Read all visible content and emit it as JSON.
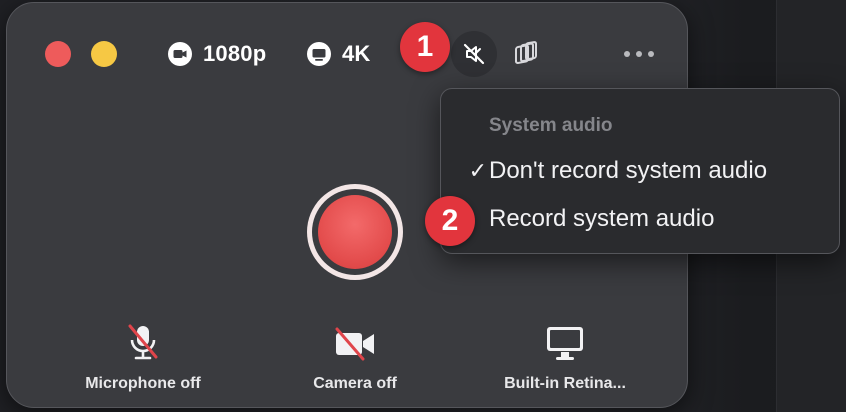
{
  "toolbar": {
    "resolution_label": "1080p",
    "quality_label": "4K"
  },
  "icons": {
    "resolution": "video-camera-icon",
    "quality": "screen-icon",
    "system_audio": "speaker-off-icon",
    "layers": "layers-icon",
    "more": "ellipsis-icon"
  },
  "badges": {
    "first": "1",
    "second": "2"
  },
  "menu": {
    "header": "System audio",
    "items": [
      {
        "label": "Don't record system audio",
        "checked": true,
        "check_mark": "✓"
      },
      {
        "label": "Record system audio",
        "checked": false,
        "check_mark": ""
      }
    ]
  },
  "bottom": {
    "microphone_label": "Microphone off",
    "camera_label": "Camera off",
    "display_label": "Built-in Retina..."
  },
  "colors": {
    "close": "#ee5b5b",
    "minimize": "#f6c844",
    "badge": "#e2353d",
    "record": "#e24a4a"
  }
}
